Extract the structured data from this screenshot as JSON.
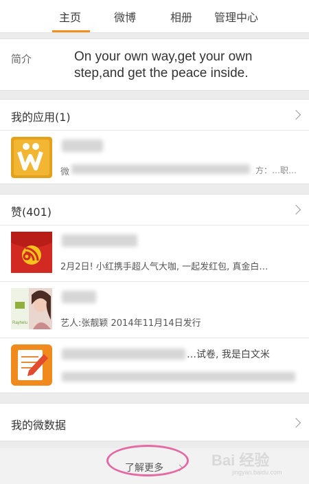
{
  "tabs": {
    "home": "主页",
    "weibo": "微博",
    "album": "相册",
    "admin": "管理中心"
  },
  "intro": {
    "label": "简介",
    "text": "On your own way,get your own step,and get the peace inside."
  },
  "apps": {
    "title": "我的应用(1)",
    "item_desc_prefix": "微",
    "item_desc_suffix": "方：…职…"
  },
  "likes": {
    "title": "赞(401)",
    "items": [
      {
        "desc": "2月2日! 小红携手超人气大咖, 一起发红包, 真金白…"
      },
      {
        "desc": "艺人:张靓颖 2014年11月14日发行"
      },
      {
        "title_visible": "…试卷, 我是白文米"
      }
    ]
  },
  "weidata": {
    "label": "我的微数据"
  },
  "more": {
    "label": "了解更多"
  },
  "watermark": {
    "text": "Bai 经验",
    "sub": "jingyan.baidu.com"
  },
  "colors": {
    "accent": "#f19019",
    "highlight": "#e46aa4"
  }
}
